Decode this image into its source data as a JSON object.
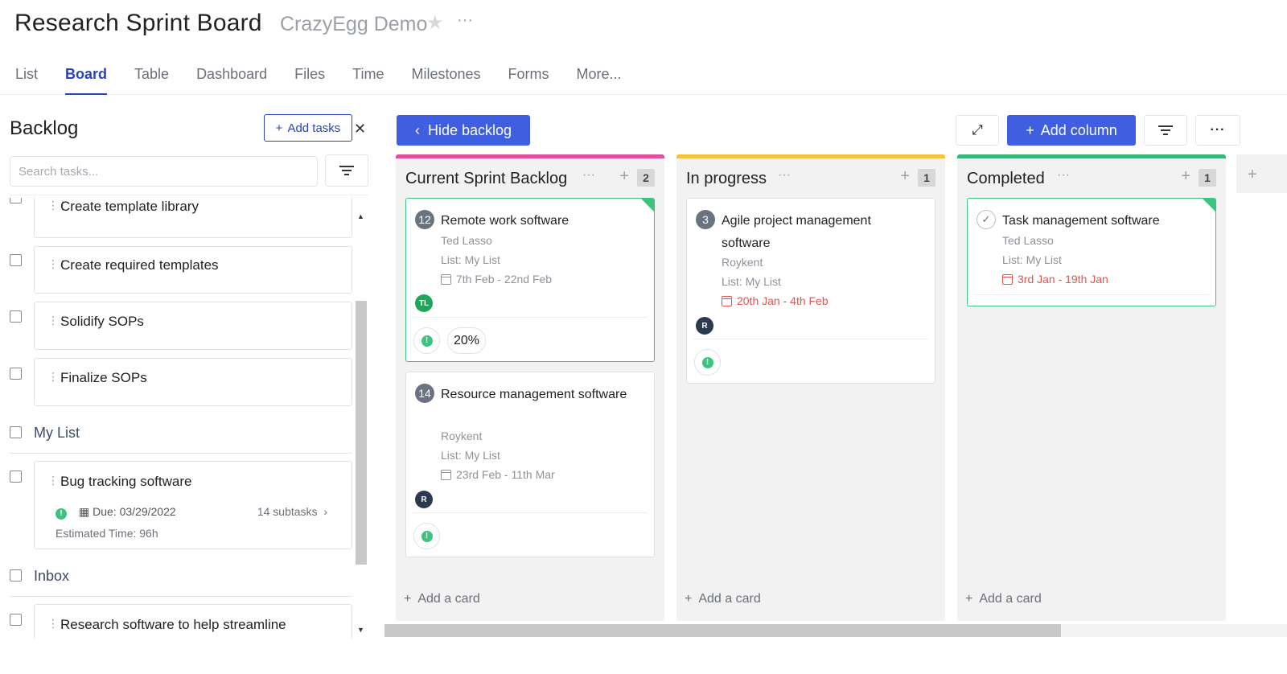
{
  "header": {
    "title": "Research Sprint Board",
    "subtitle": "CrazyEgg Demo",
    "star_icon": "star-icon",
    "more": "···"
  },
  "tabs": [
    "List",
    "Board",
    "Table",
    "Dashboard",
    "Files",
    "Time",
    "Milestones",
    "Forms",
    "More..."
  ],
  "active_tab": "Board",
  "backlog": {
    "title": "Backlog",
    "add_tasks": "Add tasks",
    "search_placeholder": "Search tasks...",
    "items": [
      {
        "title": "Create template library"
      },
      {
        "title": "Create required templates"
      },
      {
        "title": "Solidify SOPs"
      },
      {
        "title": "Finalize SOPs"
      }
    ],
    "groups": [
      {
        "name": "My List",
        "task": {
          "title": "Bug tracking software",
          "due_label": "Due:",
          "due_date": "03/29/2022",
          "subtasks": "14 subtasks",
          "estimated": "Estimated Time: 96h"
        }
      },
      {
        "name": "Inbox",
        "task": {
          "title": "Research software to help streamline"
        }
      }
    ]
  },
  "toolbar": {
    "hide_backlog": "Hide backlog",
    "add_column": "Add column"
  },
  "columns": [
    {
      "title": "Current Sprint Backlog",
      "count": "2",
      "color": "#e0519b",
      "add_card": "Add a card",
      "cards": [
        {
          "badge": "12",
          "title": "Remote work software",
          "assignee": "Ted Lasso",
          "list": "List: My List",
          "dates": "7th Feb - 22nd Feb",
          "avatar": "TL",
          "progress": "20%"
        },
        {
          "badge": "14",
          "title": "Resource management software",
          "assignee": "Roykent",
          "list": "List: My List",
          "dates": "23rd Feb - 11th Mar",
          "avatar": "R"
        }
      ]
    },
    {
      "title": "In progress",
      "count": "1",
      "color": "#f7c23e",
      "add_card": "Add a card",
      "cards": [
        {
          "badge": "3",
          "title": "Agile project management software",
          "assignee": "Roykent",
          "list": "List: My List",
          "dates": "20th Jan - 4th Feb",
          "avatar": "R"
        }
      ]
    },
    {
      "title": "Completed",
      "count": "1",
      "color": "#3bb57a",
      "add_card": "Add a card",
      "cards": [
        {
          "title": "Task management software",
          "assignee": "Ted Lasso",
          "list": "List: My List",
          "dates": "3rd Jan - 19th Jan"
        }
      ]
    }
  ],
  "colors": {
    "accent": "#3f5ee0",
    "tab_active": "#2943b8",
    "overdue": "#e5534b",
    "priority_green": "#3bc47e",
    "avatar_tl": "#22a45d",
    "avatar_r": "#2b3a4f"
  }
}
